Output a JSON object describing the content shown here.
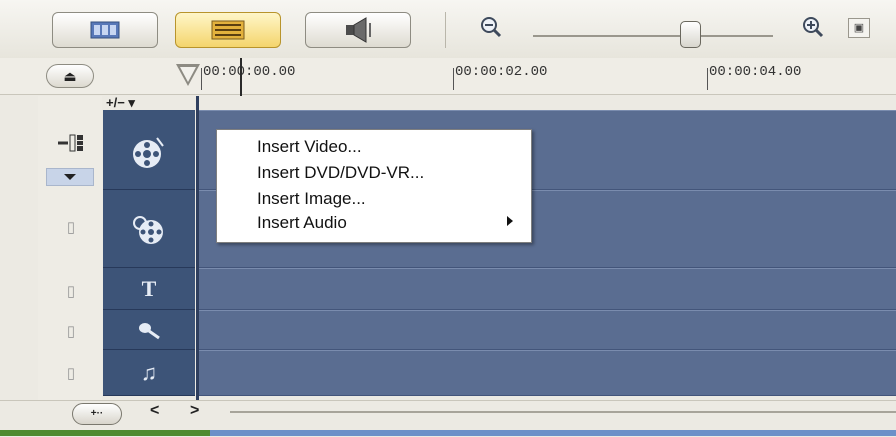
{
  "toolbar": {
    "view_buttons": [
      {
        "name": "storyboard-view",
        "active": false
      },
      {
        "name": "timeline-view",
        "active": true
      },
      {
        "name": "audio-view",
        "active": false
      }
    ],
    "zoom_out_icon": "zoom-out-icon",
    "zoom_in_icon": "zoom-in-icon",
    "fit_icon": "fit-to-window-icon"
  },
  "ruler": {
    "timecodes": [
      "00:00:00.00",
      "00:00:02.00",
      "00:00:04.00"
    ]
  },
  "timeline": {
    "add_track_label": "+/− ▾",
    "tracks": [
      "video-track",
      "overlay-track",
      "title-track",
      "voice-track",
      "music-track"
    ]
  },
  "context_menu": {
    "items": [
      {
        "label": "Insert Video...",
        "has_submenu": false
      },
      {
        "label": "Insert DVD/DVD-VR...",
        "has_submenu": false
      },
      {
        "label": "Insert Image...",
        "has_submenu": false
      },
      {
        "label": "Insert Audio",
        "has_submenu": true
      }
    ]
  },
  "colors": {
    "track_header": "#3d5478",
    "track_area": "#5a6d91",
    "active_button": "#f4d56d"
  }
}
